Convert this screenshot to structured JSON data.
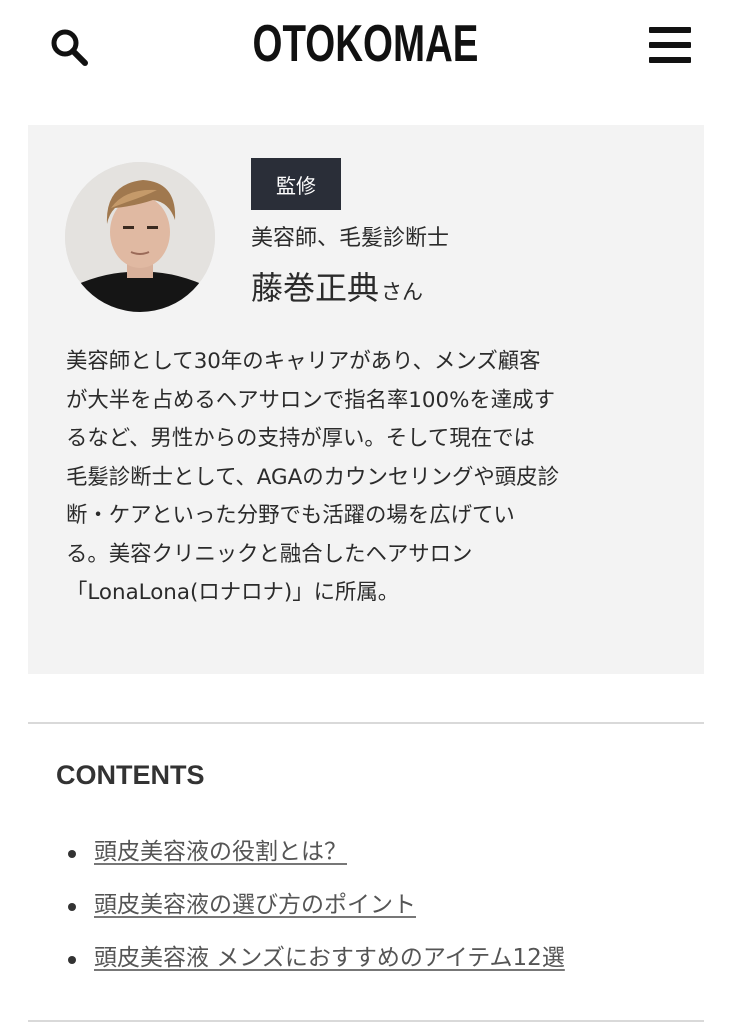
{
  "header": {
    "logo": "OTOKOMAE",
    "search_icon": "search-icon",
    "menu_icon": "hamburger-menu-icon"
  },
  "supervisor": {
    "badge": "監修",
    "role": "美容師、毛髪診断士",
    "name": "藤巻正典",
    "name_suffix": "さん",
    "bio_lines": [
      "美容師として30年のキャリアがあり、メンズ顧客",
      "が大半を占めるヘアサロンで指名率100%を達成す",
      "るなど、男性からの支持が厚い。そして現在では",
      "毛髪診断士として、AGAのカウンセリングや頭皮診",
      "断・ケアといった分野でも活躍の場を広げてい",
      "る。美容クリニックと融合したヘアサロン",
      "「LonaLona(ロナロナ)」に所属。"
    ]
  },
  "contents": {
    "title": "CONTENTS",
    "items": [
      "頭皮美容液の役割とは？",
      "頭皮美容液の選び方のポイント",
      "頭皮美容液 メンズにおすすめのアイテム12選"
    ]
  },
  "colors": {
    "background": "#ffffff",
    "panel": "#f3f3f3",
    "badge_bg": "#2a2e38",
    "text": "#2b2b2b",
    "link": "#555555"
  }
}
